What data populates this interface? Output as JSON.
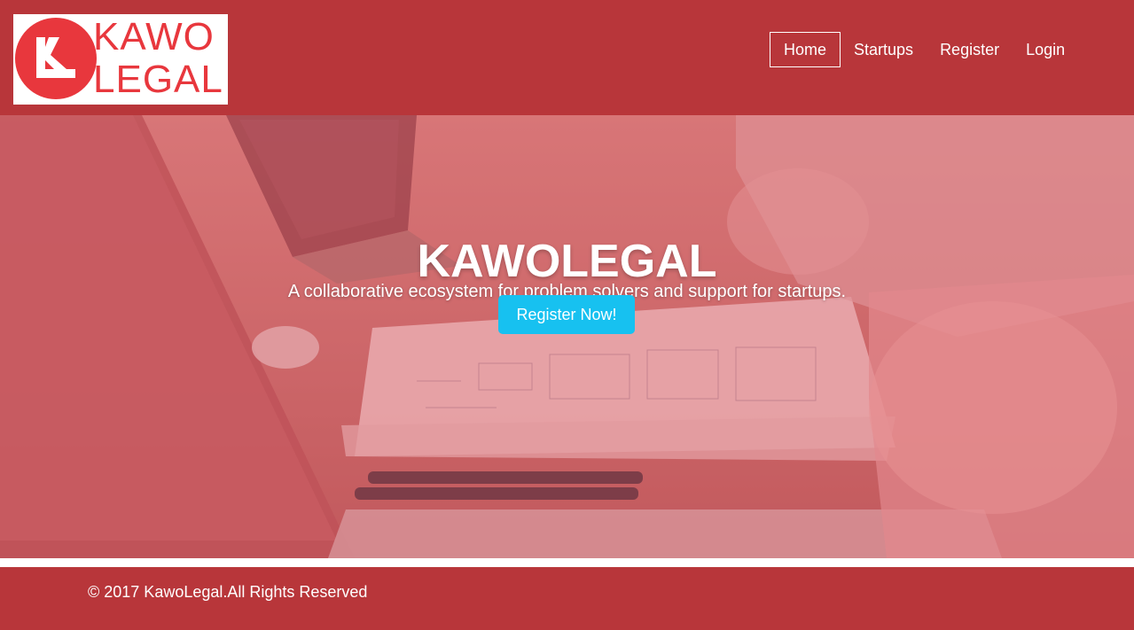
{
  "header": {
    "logo": {
      "line1": "KAWO",
      "line2": "LEGAL"
    },
    "nav": [
      {
        "label": "Home",
        "active": true
      },
      {
        "label": "Startups",
        "active": false
      },
      {
        "label": "Register",
        "active": false
      },
      {
        "label": "Login",
        "active": false
      }
    ]
  },
  "hero": {
    "title": "KAWOLEGAL",
    "subtitle": "A collaborative ecosystem for problem solvers and support for startups.",
    "cta_label": "Register Now!"
  },
  "footer": {
    "copyright": "© 2017 KawoLegal.All Rights Reserved"
  },
  "colors": {
    "brand_red": "#b8363a",
    "logo_red": "#e8373d",
    "cta_blue": "#17c1f0"
  },
  "icons": {
    "logo_mark": "kl-monogram-icon"
  }
}
